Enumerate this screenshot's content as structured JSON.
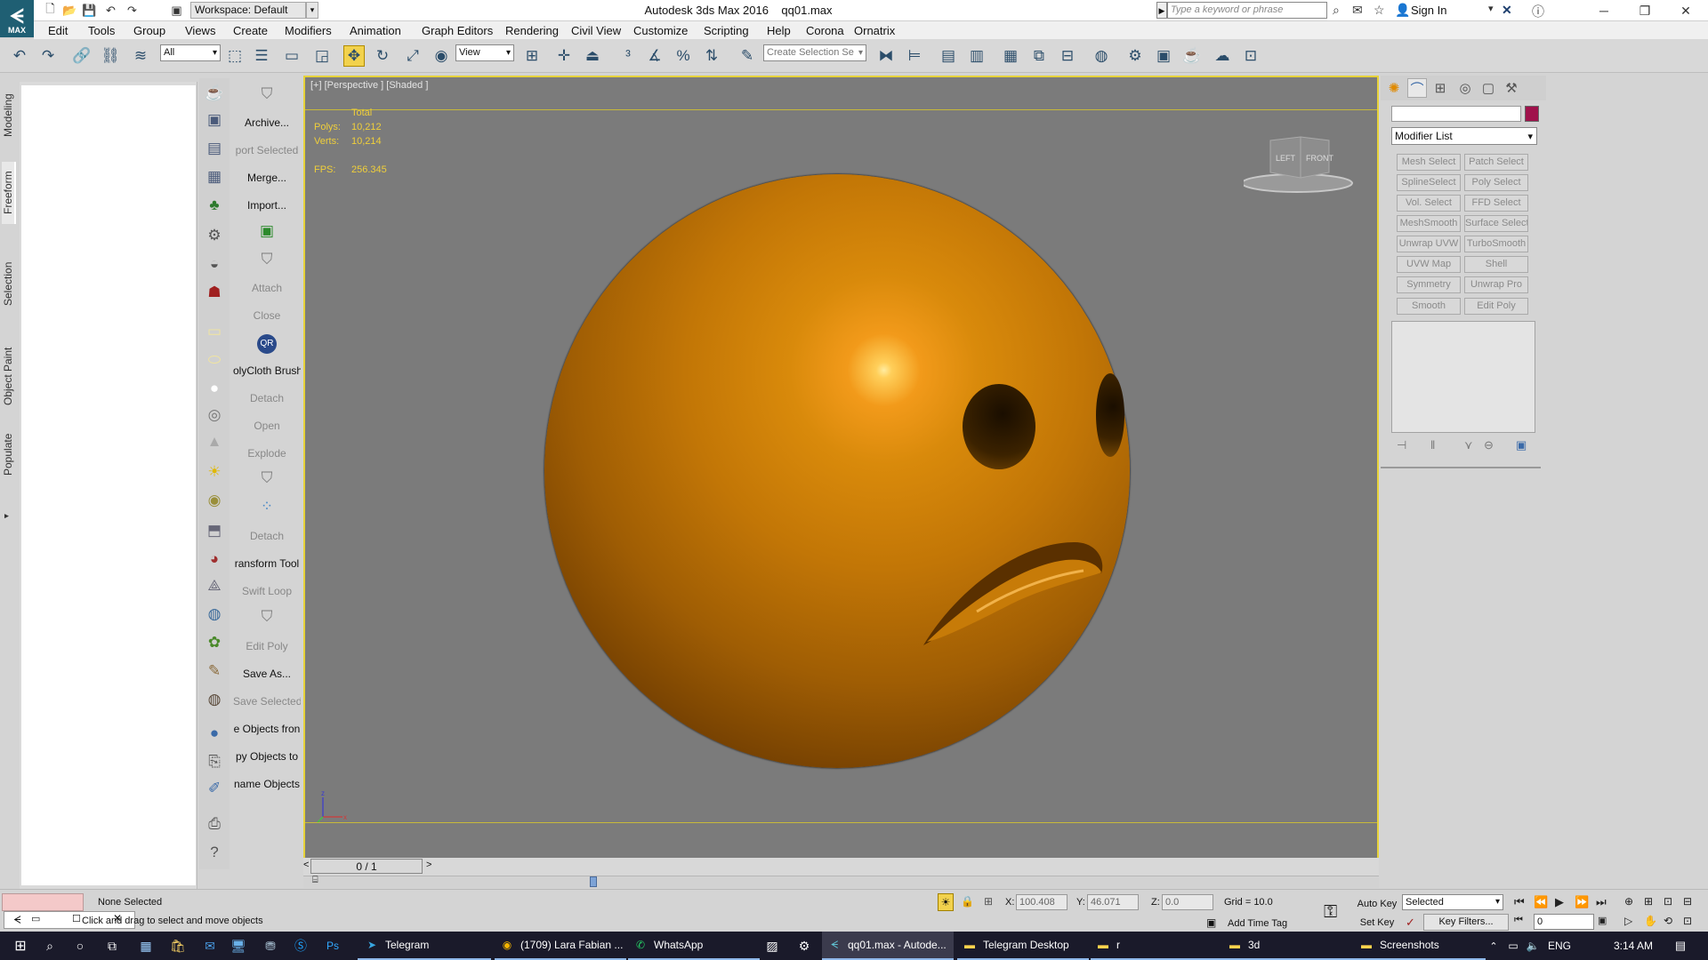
{
  "titlebar": {
    "app_title": "Autodesk 3ds Max 2016",
    "file_name": "qq01.max",
    "workspace": "Workspace: Default",
    "search_placeholder": "Type a keyword or phrase",
    "sign_in": "Sign In"
  },
  "menu": [
    "Edit",
    "Tools",
    "Group",
    "Views",
    "Create",
    "Modifiers",
    "Animation",
    "Graph Editors",
    "Rendering",
    "Civil View",
    "Customize",
    "Scripting",
    "Help",
    "Corona",
    "Ornatrix"
  ],
  "toolbar": {
    "filter_value": "All",
    "ref_coord": "View",
    "selection_set_placeholder": "Create Selection Se"
  },
  "ribbon_tabs": [
    "Modeling",
    "Freeform",
    "Selection",
    "Object Paint",
    "Populate"
  ],
  "graphite_panel": [
    {
      "label": "Archive...",
      "disabled": false
    },
    {
      "label": "port Selected",
      "disabled": true
    },
    {
      "label": "Merge...",
      "disabled": false
    },
    {
      "label": "Import...",
      "disabled": false
    },
    {
      "label": "Attach",
      "disabled": true
    },
    {
      "label": "Close",
      "disabled": true
    },
    {
      "label": "olyCloth Brush",
      "disabled": false
    },
    {
      "label": "Detach",
      "disabled": true
    },
    {
      "label": "Open",
      "disabled": true
    },
    {
      "label": "Explode",
      "disabled": true
    },
    {
      "label": "Detach",
      "disabled": true
    },
    {
      "label": "ransform Tool",
      "disabled": false
    },
    {
      "label": "Swift Loop",
      "disabled": true
    },
    {
      "label": "Edit Poly",
      "disabled": true
    },
    {
      "label": "Save As...",
      "disabled": false
    },
    {
      "label": "Save Selected",
      "disabled": true
    },
    {
      "label": "e Objects fron",
      "disabled": false
    },
    {
      "label": "py Objects to",
      "disabled": false
    },
    {
      "label": "name Objects",
      "disabled": false
    }
  ],
  "viewport": {
    "label": "[+] [Perspective ] [Shaded ]",
    "stats": {
      "total_label": "Total",
      "polys_label": "Polys:",
      "polys_value": "10,212",
      "verts_label": "Verts:",
      "verts_value": "10,214",
      "fps_label": "FPS:",
      "fps_value": "256.345"
    },
    "viewcube_left": "LEFT",
    "viewcube_front": "FRONT",
    "object_color": "#d98a0b"
  },
  "timeslider": {
    "value": "0 / 1"
  },
  "command_panel": {
    "object_color": "#a0124b",
    "modifier_list": "Modifier List",
    "modifier_buttons": [
      "Mesh Select",
      "Patch Select",
      "SplineSelect",
      "Poly Select",
      "Vol. Select",
      "FFD Select",
      "MeshSmooth",
      "Surface Select",
      "Unwrap UVW",
      "TurboSmooth",
      "UVW Map",
      "Shell",
      "Symmetry",
      "Unwrap Pro",
      "Smooth",
      "Edit Poly"
    ]
  },
  "status": {
    "selection": "None Selected",
    "prompt": "Click and drag to select and move objects",
    "x_label": "X:",
    "x_value": "100.408",
    "y_label": "Y:",
    "y_value": "46.071",
    "z_label": "Z:",
    "z_value": "0.0",
    "grid": "Grid = 10.0",
    "add_time_tag": "Add Time Tag",
    "auto_key": "Auto Key",
    "set_key": "Set Key",
    "key_mode": "Selected",
    "key_filters": "Key Filters...",
    "frame": "0"
  },
  "taskbar": {
    "items": [
      "Telegram",
      "(1709) Lara Fabian ...",
      "WhatsApp",
      "qq01.max - Autode...",
      "Telegram Desktop",
      "r",
      "3d",
      "Screenshots"
    ],
    "lang": "ENG",
    "time": "3:14 AM"
  }
}
